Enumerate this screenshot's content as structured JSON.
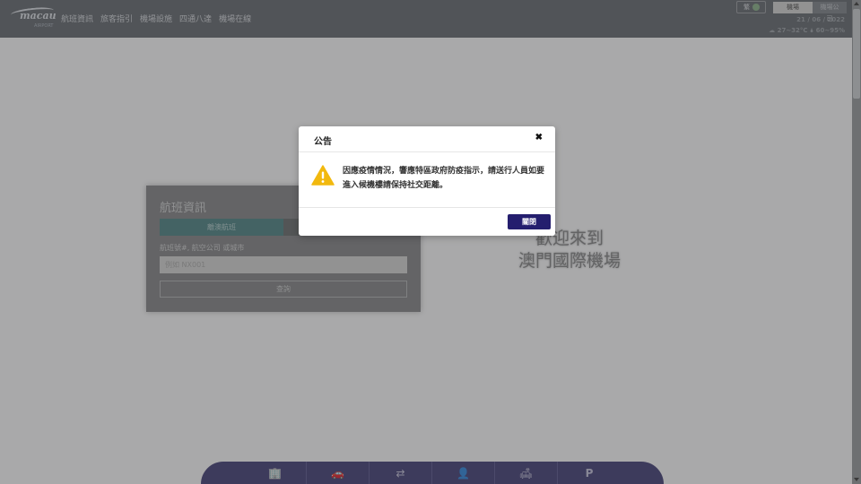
{
  "header": {
    "logo_text": "macau",
    "logo_sub": "AIRPORT",
    "nav": [
      "航班資訊",
      "旅客指引",
      "機場設施",
      "四通八達",
      "機場在線"
    ],
    "lang_label": "繁",
    "segments": [
      "機場",
      "機場公司"
    ],
    "date": "21 / 06 / 2022",
    "weather": "☁ 27~32°C  🌢 60~95%"
  },
  "flight_card": {
    "title": "航班資訊",
    "tab_active": "離澳航班",
    "label": "航班號#, 航空公司 或城市",
    "input_placeholder": "例如 NX001",
    "search_button": "查詢"
  },
  "welcome": {
    "line1": "歡迎來到",
    "line2": "澳門國際機場"
  },
  "bottom_nav": [
    {
      "icon": "building-icon",
      "glyph": "🏢"
    },
    {
      "icon": "car-icon",
      "glyph": "🚗"
    },
    {
      "icon": "transfer-icon",
      "glyph": "⇄"
    },
    {
      "icon": "user-check-icon",
      "glyph": "👤"
    },
    {
      "icon": "sofa-icon",
      "glyph": "🛋"
    },
    {
      "icon": "parking-icon",
      "glyph": "P"
    }
  ],
  "modal": {
    "title": "公告",
    "close_glyph": "✖",
    "message": "因應疫情情況，響應特區政府防疫指示，請送行人員如要進入候機樓請保持社交距離。",
    "close_button": "關閉"
  },
  "colors": {
    "modal_button": "#241e6e",
    "warning": "#f2b90f",
    "bottom_bar": "#2f2a66"
  }
}
